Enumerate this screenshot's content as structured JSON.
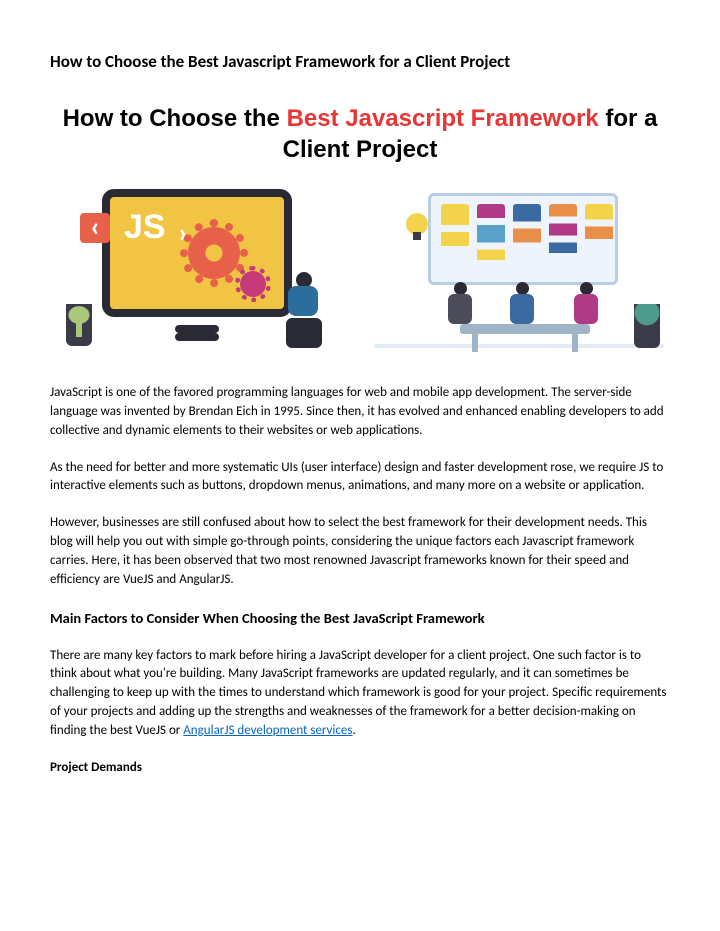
{
  "doc_title": "How to Choose the Best Javascript Framework for a Client Project",
  "hero": {
    "part1": "How to Choose the ",
    "part2": "Best Javascript Framework",
    "part3": " for a Client Project"
  },
  "paragraphs": {
    "p1": "JavaScript is one of the favored programming languages for web and mobile app development. The server-side language was invented by Brendan Eich in 1995. Since then, it has evolved and enhanced enabling developers to add collective and dynamic elements to their websites or web applications.",
    "p2": "As the need for better and more systematic UIs (user interface) design and faster development rose, we require JS to interactive elements such as buttons, dropdown menus, animations, and many more on a website or application.",
    "p3": "However, businesses are still confused about how to select the best framework for their development needs. This blog will help you out with simple go-through points, considering the unique factors each Javascript framework carries. Here, it has been observed that two most renowned Javascript frameworks known for their speed and efficiency are VueJS and AngularJS.",
    "p4a": "There are many key factors to mark before hiring a JavaScript developer for a client project. One such factor is to think about what you're building. Many JavaScript frameworks are updated regularly, and it can sometimes be challenging to keep up with the times to understand which framework is good for your project. Specific requirements of your projects and adding up the strengths and weaknesses of the framework for a better decision-making on finding the best VueJS or ",
    "p4_link": "AngularJS development services",
    "p4b": "."
  },
  "headings": {
    "main_factors": "Main Factors to Consider When Choosing the Best JavaScript Framework",
    "project_demands": "Project Demands"
  }
}
